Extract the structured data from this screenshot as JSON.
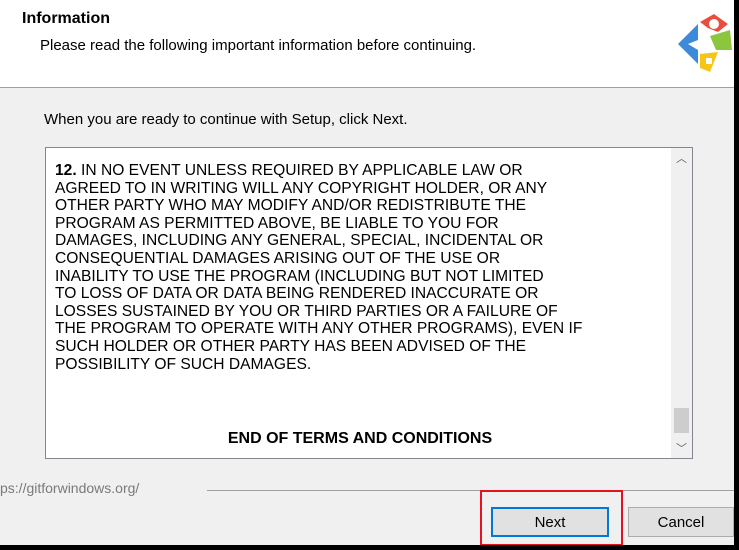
{
  "header": {
    "title": "Information",
    "subtitle": "Please read the following important information before continuing."
  },
  "body": {
    "intro": "When you are ready to continue with Setup, click Next."
  },
  "license": {
    "section_number": "12.",
    "section_text": " IN NO EVENT UNLESS REQUIRED BY APPLICABLE LAW OR\nAGREED TO IN WRITING WILL ANY COPYRIGHT HOLDER, OR ANY\nOTHER PARTY WHO MAY MODIFY AND/OR REDISTRIBUTE THE\nPROGRAM AS PERMITTED ABOVE, BE LIABLE TO YOU FOR\nDAMAGES, INCLUDING ANY GENERAL, SPECIAL, INCIDENTAL OR\nCONSEQUENTIAL DAMAGES ARISING OUT OF THE USE OR\nINABILITY TO USE THE PROGRAM (INCLUDING BUT NOT LIMITED\nTO LOSS OF DATA OR DATA BEING RENDERED INACCURATE OR\nLOSSES SUSTAINED BY YOU OR THIRD PARTIES OR A FAILURE OF\nTHE PROGRAM TO OPERATE WITH ANY OTHER PROGRAMS), EVEN IF\nSUCH HOLDER OR OTHER PARTY HAS BEEN ADVISED OF THE\nPOSSIBILITY OF SUCH DAMAGES.",
    "end_text": "END OF TERMS AND CONDITIONS"
  },
  "scrollbar": {
    "up_icon": "chevron-up-icon",
    "down_icon": "chevron-down-icon"
  },
  "footer": {
    "url": "ps://gitforwindows.org/"
  },
  "buttons": {
    "next": "Next",
    "cancel": "Cancel"
  },
  "colors": {
    "focus_border": "#0078d7",
    "highlight": "#e81123",
    "dialog_bg": "#f0f0f0"
  },
  "icons": {
    "logo": "git-logo-icon"
  }
}
